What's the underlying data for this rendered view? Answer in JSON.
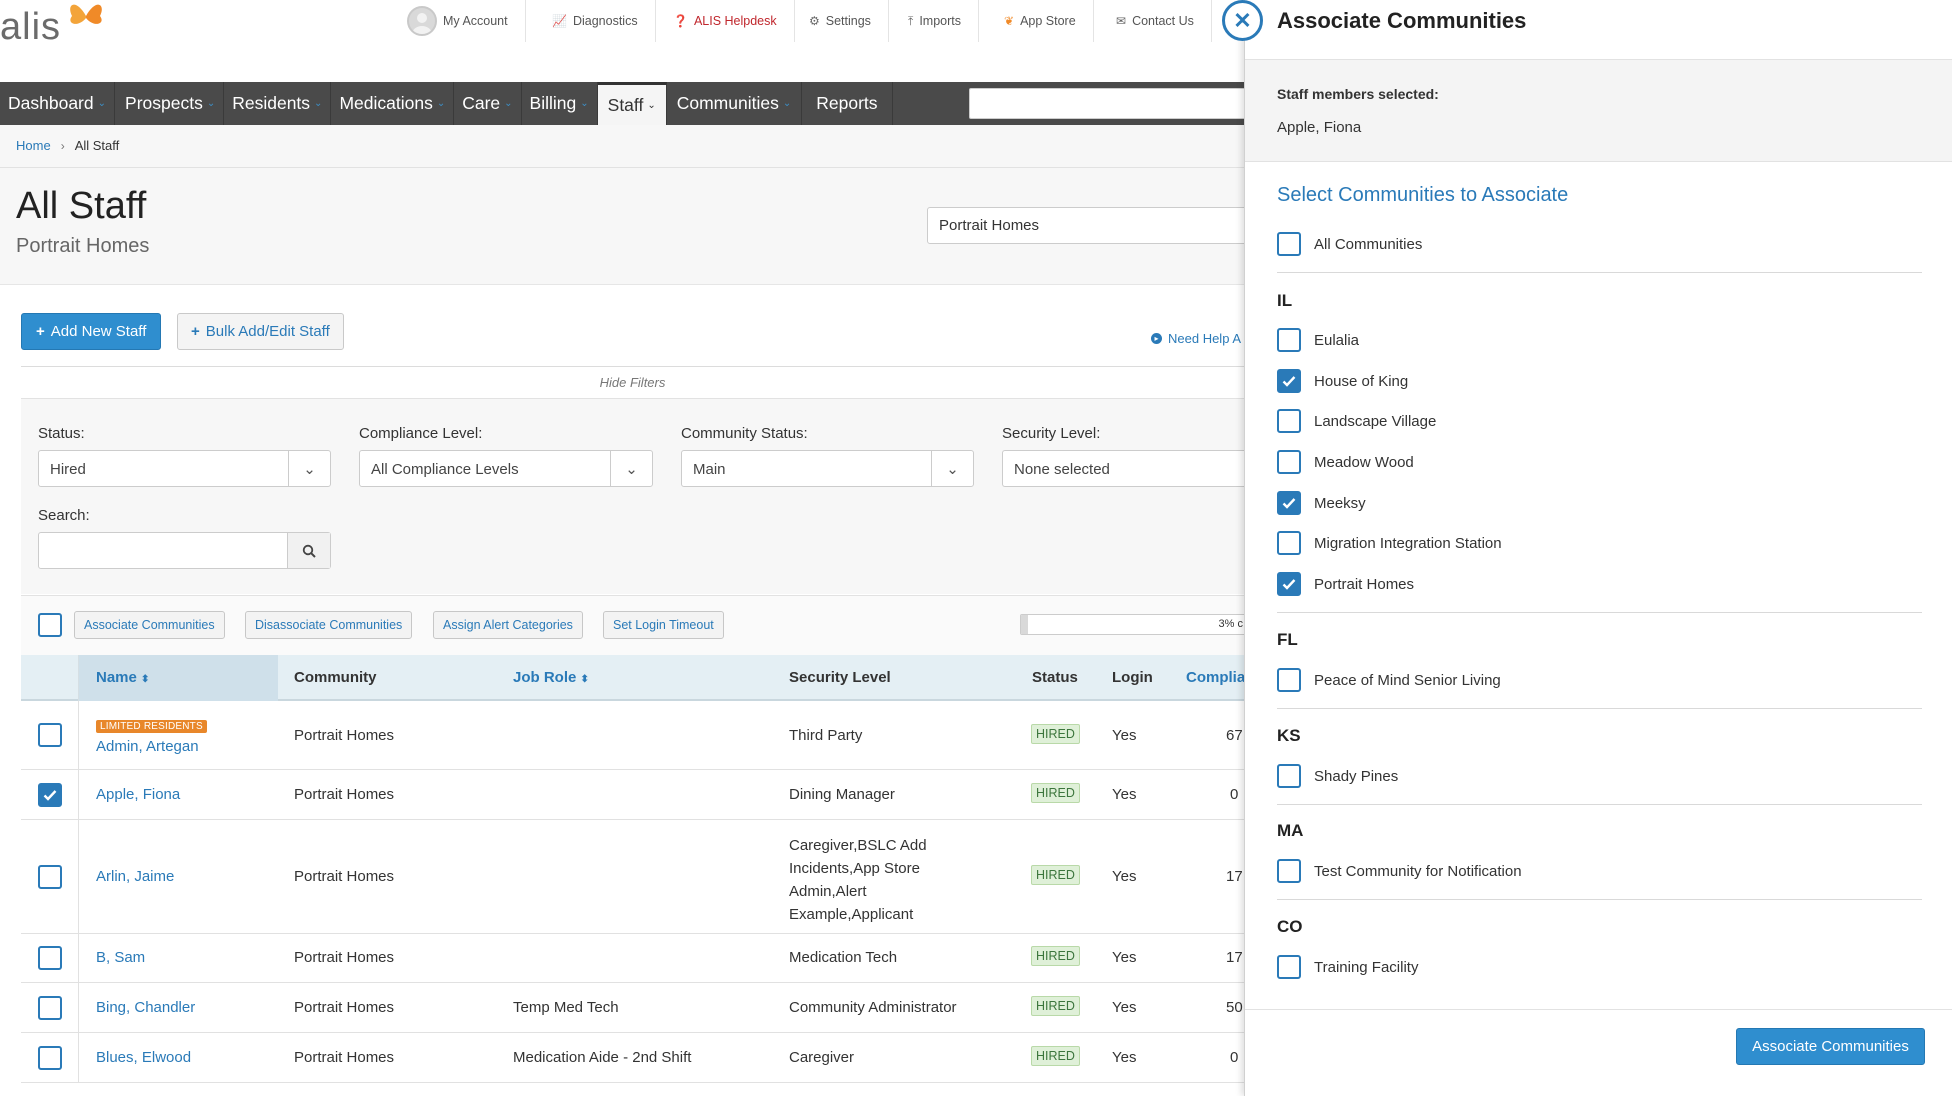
{
  "logo": {
    "text": "alis"
  },
  "utility_nav": [
    {
      "label": "My Account",
      "icon": "avatar-icon"
    },
    {
      "label": "Diagnostics",
      "icon": "chart-icon"
    },
    {
      "label": "ALIS Helpdesk",
      "icon": "question-circle-icon",
      "color": "#c0272d"
    },
    {
      "label": "Settings",
      "icon": "gear-icon"
    },
    {
      "label": "Imports",
      "icon": "upload-icon"
    },
    {
      "label": "App Store",
      "icon": "butterfly-icon"
    },
    {
      "label": "Contact Us",
      "icon": "envelope-icon"
    }
  ],
  "main_nav": [
    {
      "label": "Dashboard",
      "dropdown": true
    },
    {
      "label": "Prospects",
      "dropdown": true
    },
    {
      "label": "Residents",
      "dropdown": true
    },
    {
      "label": "Medications",
      "dropdown": true
    },
    {
      "label": "Care",
      "dropdown": true
    },
    {
      "label": "Billing",
      "dropdown": true
    },
    {
      "label": "Staff",
      "dropdown": true,
      "active": true
    },
    {
      "label": "Communities",
      "dropdown": true
    },
    {
      "label": "Reports",
      "dropdown": false
    }
  ],
  "breadcrumb": {
    "home": "Home",
    "current": "All Staff"
  },
  "page": {
    "title": "All Staff",
    "subtitle": "Portrait Homes",
    "community_select": "Portrait Homes"
  },
  "actions": {
    "add_new": "Add New Staff",
    "bulk": "Bulk Add/Edit Staff",
    "need_help": "Need Help A"
  },
  "filters": {
    "hide_label": "Hide Filters",
    "status": {
      "label": "Status:",
      "value": "Hired"
    },
    "compliance": {
      "label": "Compliance Level:",
      "value": "All Compliance Levels"
    },
    "community_status": {
      "label": "Community Status:",
      "value": "Main"
    },
    "security": {
      "label": "Security Level:",
      "value": "None selected"
    },
    "search": {
      "label": "Search:",
      "value": ""
    }
  },
  "bulk_actions": {
    "associate": "Associate Communities",
    "disassociate": "Disassociate Communities",
    "assign_alert": "Assign Alert Categories",
    "login_timeout": "Set Login Timeout",
    "progress_text": "3% c",
    "progress_fraction": 0.03
  },
  "table": {
    "columns": [
      "Name",
      "Community",
      "Job Role",
      "Security Level",
      "Status",
      "Login",
      "Complia"
    ],
    "rows": [
      {
        "badge": "LIMITED RESIDENTS",
        "name": "Admin, Artegan",
        "community": "Portrait Homes",
        "job_role": "",
        "security": "Third Party",
        "status": "HIRED",
        "login": "Yes",
        "compliance": "67",
        "checked": false
      },
      {
        "badge": "",
        "name": "Apple, Fiona",
        "community": "Portrait Homes",
        "job_role": "",
        "security": "Dining Manager",
        "status": "HIRED",
        "login": "Yes",
        "compliance": "0",
        "checked": true
      },
      {
        "badge": "",
        "name": "Arlin, Jaime",
        "community": "Portrait Homes",
        "job_role": "",
        "security": "Caregiver,BSLC Add Incidents,App Store Admin,Alert Example,Applicant",
        "security_lines": [
          "Caregiver,BSLC Add",
          "Incidents,App Store",
          "Admin,Alert",
          "Example,Applicant"
        ],
        "status": "HIRED",
        "login": "Yes",
        "compliance": "17",
        "checked": false
      },
      {
        "badge": "",
        "name": "B, Sam",
        "community": "Portrait Homes",
        "job_role": "",
        "security": "Medication Tech",
        "status": "HIRED",
        "login": "Yes",
        "compliance": "17",
        "checked": false
      },
      {
        "badge": "",
        "name": "Bing, Chandler",
        "community": "Portrait Homes",
        "job_role": "Temp Med Tech",
        "security": "Community Administrator",
        "status": "HIRED",
        "login": "Yes",
        "compliance": "50",
        "checked": false
      },
      {
        "badge": "",
        "name": "Blues, Elwood",
        "community": "Portrait Homes",
        "job_role": "Medication Aide - 2nd Shift",
        "security": "Caregiver",
        "status": "HIRED",
        "login": "Yes",
        "compliance": "0",
        "checked": false
      }
    ]
  },
  "panel": {
    "title": "Associate Communities",
    "selected_label": "Staff members selected:",
    "selected_value": "Apple, Fiona",
    "subtitle": "Select Communities to Associate",
    "all_label": "All Communities",
    "groups": [
      {
        "state": "IL",
        "items": [
          {
            "label": "Eulalia",
            "checked": false
          },
          {
            "label": "House of King",
            "checked": true
          },
          {
            "label": "Landscape Village",
            "checked": false
          },
          {
            "label": "Meadow Wood",
            "checked": false
          },
          {
            "label": "Meeksy",
            "checked": true
          },
          {
            "label": "Migration Integration Station",
            "checked": false
          },
          {
            "label": "Portrait Homes",
            "checked": true
          }
        ]
      },
      {
        "state": "FL",
        "items": [
          {
            "label": "Peace of Mind Senior Living",
            "checked": false
          }
        ]
      },
      {
        "state": "KS",
        "items": [
          {
            "label": "Shady Pines",
            "checked": false
          }
        ]
      },
      {
        "state": "MA",
        "items": [
          {
            "label": "Test Community for Notification",
            "checked": false
          }
        ]
      },
      {
        "state": "CO",
        "items": [
          {
            "label": "Training Facility",
            "checked": false
          }
        ]
      }
    ],
    "submit": "Associate Communities"
  },
  "colors": {
    "accent": "#2a7ab8",
    "nav": "#4a4a4a",
    "helpdesk": "#c0272d",
    "hired": "#3c763d",
    "limited": "#e8872a"
  }
}
